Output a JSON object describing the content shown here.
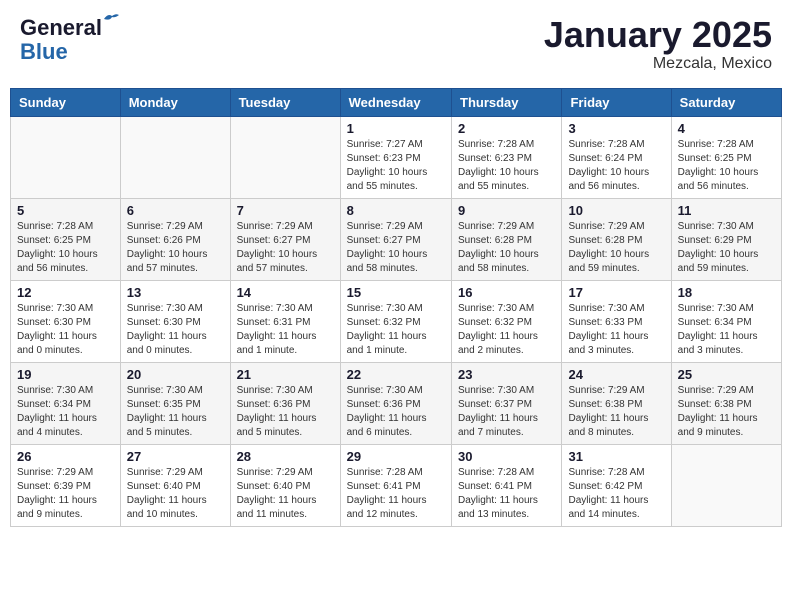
{
  "header": {
    "logo_line1": "General",
    "logo_line2": "Blue",
    "month": "January 2025",
    "location": "Mezcala, Mexico"
  },
  "weekdays": [
    "Sunday",
    "Monday",
    "Tuesday",
    "Wednesday",
    "Thursday",
    "Friday",
    "Saturday"
  ],
  "weeks": [
    [
      {
        "day": "",
        "info": ""
      },
      {
        "day": "",
        "info": ""
      },
      {
        "day": "",
        "info": ""
      },
      {
        "day": "1",
        "info": "Sunrise: 7:27 AM\nSunset: 6:23 PM\nDaylight: 10 hours and 55 minutes."
      },
      {
        "day": "2",
        "info": "Sunrise: 7:28 AM\nSunset: 6:23 PM\nDaylight: 10 hours and 55 minutes."
      },
      {
        "day": "3",
        "info": "Sunrise: 7:28 AM\nSunset: 6:24 PM\nDaylight: 10 hours and 56 minutes."
      },
      {
        "day": "4",
        "info": "Sunrise: 7:28 AM\nSunset: 6:25 PM\nDaylight: 10 hours and 56 minutes."
      }
    ],
    [
      {
        "day": "5",
        "info": "Sunrise: 7:28 AM\nSunset: 6:25 PM\nDaylight: 10 hours and 56 minutes."
      },
      {
        "day": "6",
        "info": "Sunrise: 7:29 AM\nSunset: 6:26 PM\nDaylight: 10 hours and 57 minutes."
      },
      {
        "day": "7",
        "info": "Sunrise: 7:29 AM\nSunset: 6:27 PM\nDaylight: 10 hours and 57 minutes."
      },
      {
        "day": "8",
        "info": "Sunrise: 7:29 AM\nSunset: 6:27 PM\nDaylight: 10 hours and 58 minutes."
      },
      {
        "day": "9",
        "info": "Sunrise: 7:29 AM\nSunset: 6:28 PM\nDaylight: 10 hours and 58 minutes."
      },
      {
        "day": "10",
        "info": "Sunrise: 7:29 AM\nSunset: 6:28 PM\nDaylight: 10 hours and 59 minutes."
      },
      {
        "day": "11",
        "info": "Sunrise: 7:30 AM\nSunset: 6:29 PM\nDaylight: 10 hours and 59 minutes."
      }
    ],
    [
      {
        "day": "12",
        "info": "Sunrise: 7:30 AM\nSunset: 6:30 PM\nDaylight: 11 hours and 0 minutes."
      },
      {
        "day": "13",
        "info": "Sunrise: 7:30 AM\nSunset: 6:30 PM\nDaylight: 11 hours and 0 minutes."
      },
      {
        "day": "14",
        "info": "Sunrise: 7:30 AM\nSunset: 6:31 PM\nDaylight: 11 hours and 1 minute."
      },
      {
        "day": "15",
        "info": "Sunrise: 7:30 AM\nSunset: 6:32 PM\nDaylight: 11 hours and 1 minute."
      },
      {
        "day": "16",
        "info": "Sunrise: 7:30 AM\nSunset: 6:32 PM\nDaylight: 11 hours and 2 minutes."
      },
      {
        "day": "17",
        "info": "Sunrise: 7:30 AM\nSunset: 6:33 PM\nDaylight: 11 hours and 3 minutes."
      },
      {
        "day": "18",
        "info": "Sunrise: 7:30 AM\nSunset: 6:34 PM\nDaylight: 11 hours and 3 minutes."
      }
    ],
    [
      {
        "day": "19",
        "info": "Sunrise: 7:30 AM\nSunset: 6:34 PM\nDaylight: 11 hours and 4 minutes."
      },
      {
        "day": "20",
        "info": "Sunrise: 7:30 AM\nSunset: 6:35 PM\nDaylight: 11 hours and 5 minutes."
      },
      {
        "day": "21",
        "info": "Sunrise: 7:30 AM\nSunset: 6:36 PM\nDaylight: 11 hours and 5 minutes."
      },
      {
        "day": "22",
        "info": "Sunrise: 7:30 AM\nSunset: 6:36 PM\nDaylight: 11 hours and 6 minutes."
      },
      {
        "day": "23",
        "info": "Sunrise: 7:30 AM\nSunset: 6:37 PM\nDaylight: 11 hours and 7 minutes."
      },
      {
        "day": "24",
        "info": "Sunrise: 7:29 AM\nSunset: 6:38 PM\nDaylight: 11 hours and 8 minutes."
      },
      {
        "day": "25",
        "info": "Sunrise: 7:29 AM\nSunset: 6:38 PM\nDaylight: 11 hours and 9 minutes."
      }
    ],
    [
      {
        "day": "26",
        "info": "Sunrise: 7:29 AM\nSunset: 6:39 PM\nDaylight: 11 hours and 9 minutes."
      },
      {
        "day": "27",
        "info": "Sunrise: 7:29 AM\nSunset: 6:40 PM\nDaylight: 11 hours and 10 minutes."
      },
      {
        "day": "28",
        "info": "Sunrise: 7:29 AM\nSunset: 6:40 PM\nDaylight: 11 hours and 11 minutes."
      },
      {
        "day": "29",
        "info": "Sunrise: 7:28 AM\nSunset: 6:41 PM\nDaylight: 11 hours and 12 minutes."
      },
      {
        "day": "30",
        "info": "Sunrise: 7:28 AM\nSunset: 6:41 PM\nDaylight: 11 hours and 13 minutes."
      },
      {
        "day": "31",
        "info": "Sunrise: 7:28 AM\nSunset: 6:42 PM\nDaylight: 11 hours and 14 minutes."
      },
      {
        "day": "",
        "info": ""
      }
    ]
  ]
}
